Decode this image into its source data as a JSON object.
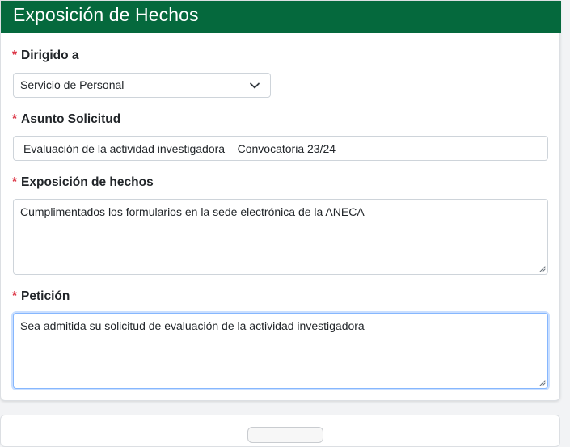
{
  "header": {
    "title": "Exposición de Hechos"
  },
  "form": {
    "required_mark": "*",
    "dirigido": {
      "label": "Dirigido a",
      "selected": "Servicio de Personal"
    },
    "asunto": {
      "label": "Asunto Solicitud",
      "value": "Evaluación de la actividad investigadora – Convocatoria 23/24"
    },
    "exposicion": {
      "label": "Exposición de hechos",
      "value": "Cumplimentados los formularios en la sede electrónica de la ANECA"
    },
    "peticion": {
      "label": "Petición",
      "value": "Sea admitida su solicitud de evaluación de la actividad investigadora"
    }
  },
  "colors": {
    "header_bg": "#05693d",
    "required": "#dc3545",
    "focus_border": "#86b7fe"
  },
  "icons": {
    "select_arrow": "chevron-down-icon",
    "resize": "resize-grip-icon"
  }
}
